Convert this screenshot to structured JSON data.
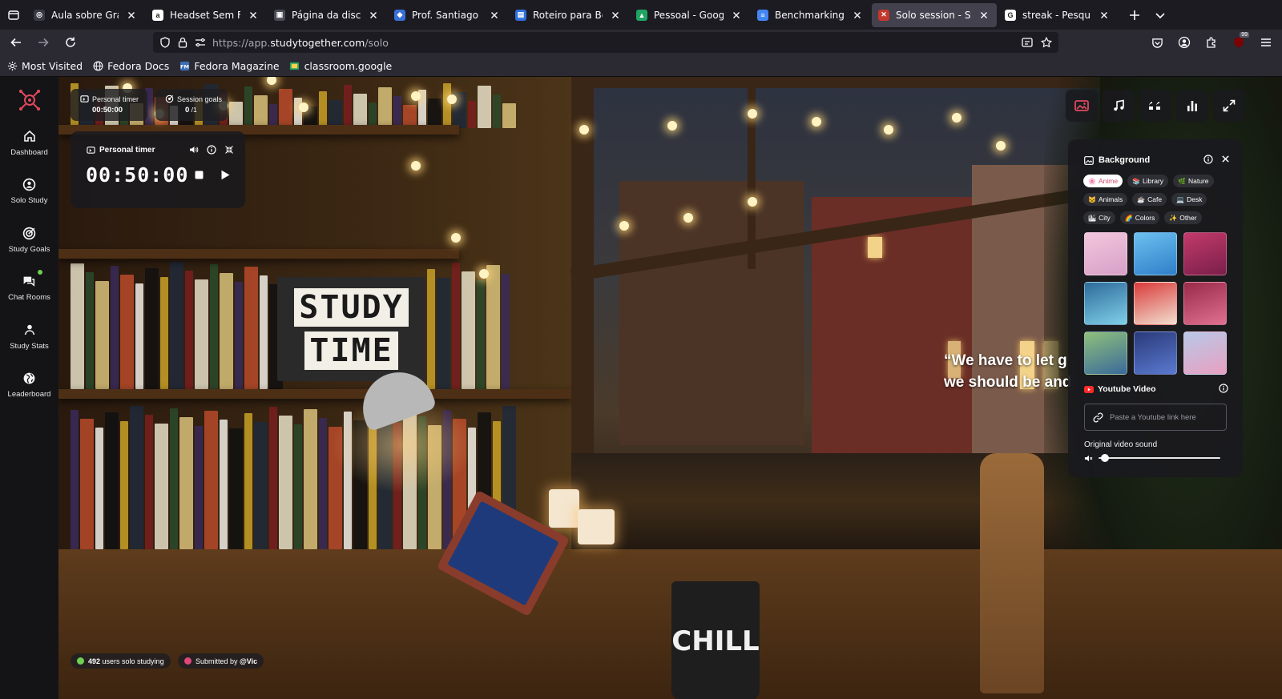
{
  "browser": {
    "tabs": [
      {
        "title": "Aula sobre Grafos",
        "favicon_color": "#3a3a44",
        "favicon_text": "◎"
      },
      {
        "title": "Headset Sem Fio Lo",
        "favicon_color": "#ffffff",
        "favicon_text": "a"
      },
      {
        "title": "Página da disciplina",
        "favicon_color": "#4a4a55",
        "favicon_text": "▣"
      },
      {
        "title": "Prof. Santiago V. Ra",
        "favicon_color": "#3a6fd8",
        "favicon_text": "◆"
      },
      {
        "title": "Roteiro para Benchm",
        "favicon_color": "#2f6fe0",
        "favicon_text": "▤"
      },
      {
        "title": "Pessoal - Google Dri",
        "favicon_color": "#1fa463",
        "favicon_text": "▲"
      },
      {
        "title": "Benchmarking - Doc",
        "favicon_color": "#4285f4",
        "favicon_text": "≡"
      },
      {
        "title": "Solo session - Study",
        "favicon_color": "#c2382f",
        "favicon_text": "✕"
      },
      {
        "title": "streak - Pesquisa Go",
        "favicon_color": "#ffffff",
        "favicon_text": "G"
      }
    ],
    "active_tab_index": 7,
    "url_prefix": "https://app.",
    "url_host": "studytogether.com",
    "url_path": "/solo",
    "notif_badge": "99",
    "bookmarks": [
      {
        "label": "Most Visited",
        "icon": "gear-icon"
      },
      {
        "label": "Fedora Docs",
        "icon": "globe-icon"
      },
      {
        "label": "Fedora Magazine",
        "icon": "fedora-magazine-icon"
      },
      {
        "label": "classroom.google",
        "icon": "classroom-icon"
      }
    ]
  },
  "sidebar": {
    "items": [
      {
        "label": "Dashboard",
        "icon": "home-icon"
      },
      {
        "label": "Solo Study",
        "icon": "solo-study-icon"
      },
      {
        "label": "Study Goals",
        "icon": "target-icon"
      },
      {
        "label": "Chat Rooms",
        "icon": "chat-icon"
      },
      {
        "label": "Study Stats",
        "icon": "person-icon"
      },
      {
        "label": "Leaderboard",
        "icon": "globe-icon"
      }
    ]
  },
  "chips": {
    "personal_timer": {
      "label": "Personal timer",
      "value": "00:50:00"
    },
    "session_goals": {
      "label": "Session goals",
      "value_done": "0",
      "value_total": " /1"
    }
  },
  "timer_card": {
    "title": "Personal timer",
    "time": "00:50:00"
  },
  "scene": {
    "quote_line1": "“We have to let g",
    "quote_line2": "we should be and",
    "sign_top": "STUDY",
    "sign_bottom": "TIME",
    "mug_text": "CHILL"
  },
  "background_panel": {
    "title": "Background",
    "categories": [
      {
        "label": "Anime",
        "emoji": "🌸",
        "active": true
      },
      {
        "label": "Library",
        "emoji": "📚",
        "active": false
      },
      {
        "label": "Nature",
        "emoji": "🌿",
        "active": false
      },
      {
        "label": "Animals",
        "emoji": "🐱",
        "active": false
      },
      {
        "label": "Cafe",
        "emoji": "☕",
        "active": false
      },
      {
        "label": "Desk",
        "emoji": "💻",
        "active": false
      },
      {
        "label": "City",
        "emoji": "🏙",
        "active": false
      },
      {
        "label": "Colors",
        "emoji": "🌈",
        "active": false
      },
      {
        "label": "Other",
        "emoji": "✨",
        "active": false
      }
    ],
    "thumbnail_colors": [
      [
        "#f3c6dc",
        "#d6a0c8"
      ],
      [
        "#6cc0ef",
        "#2f7fc9"
      ],
      [
        "#c23a6a",
        "#7a1f4a"
      ],
      [
        "#2e6a9a",
        "#7fd0e8"
      ],
      [
        "#d93a3a",
        "#f2e0d0"
      ],
      [
        "#9a2a4a",
        "#e07090"
      ],
      [
        "#8fc07a",
        "#3a6a9a"
      ],
      [
        "#2a3a7a",
        "#5a7ad0"
      ],
      [
        "#b8c8e8",
        "#e8a0c0"
      ]
    ],
    "youtube_title": "Youtube Video",
    "youtube_placeholder": "Paste a Youtube link here",
    "youtube_value": "",
    "sound_label": "Original video sound",
    "sound_level": 0.05
  },
  "footer": {
    "users_count": "492",
    "users_text": " users solo studying",
    "submitted_prefix": "Submitted by ",
    "submitted_user": "@Vic"
  },
  "colors": {
    "accent": "#e0495f",
    "online_green": "#6fd14f",
    "submit_pink": "#e0487a",
    "youtube_red": "#ff2a2a"
  }
}
